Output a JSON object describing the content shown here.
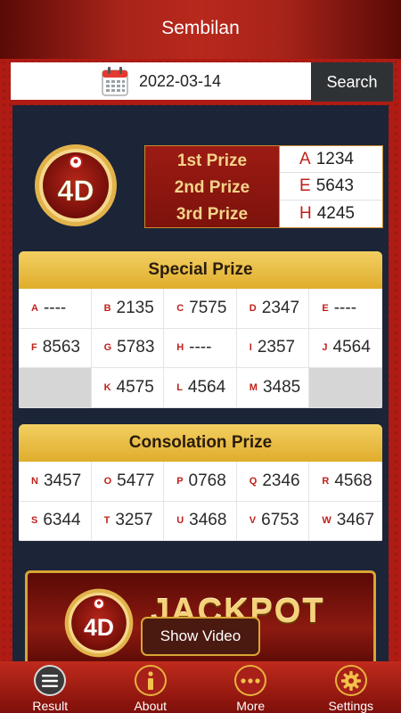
{
  "header": {
    "title": "Sembilan"
  },
  "search": {
    "date": "2022-03-14",
    "button": "Search",
    "icon": "calendar-icon"
  },
  "logo": {
    "text": "4D"
  },
  "top_prizes": [
    {
      "label": "1st Prize",
      "letter": "A",
      "number": "1234"
    },
    {
      "label": "2nd Prize",
      "letter": "E",
      "number": "5643"
    },
    {
      "label": "3rd Prize",
      "letter": "H",
      "number": "4245"
    }
  ],
  "special": {
    "title": "Special Prize",
    "cells": [
      {
        "letter": "A",
        "number": "----"
      },
      {
        "letter": "B",
        "number": "2135"
      },
      {
        "letter": "C",
        "number": "7575"
      },
      {
        "letter": "D",
        "number": "2347"
      },
      {
        "letter": "E",
        "number": "----"
      },
      {
        "letter": "F",
        "number": "8563"
      },
      {
        "letter": "G",
        "number": "5783"
      },
      {
        "letter": "H",
        "number": "----"
      },
      {
        "letter": "I",
        "number": "2357"
      },
      {
        "letter": "J",
        "number": "4564"
      },
      {
        "letter": "",
        "number": ""
      },
      {
        "letter": "K",
        "number": "4575"
      },
      {
        "letter": "L",
        "number": "4564"
      },
      {
        "letter": "M",
        "number": "3485"
      },
      {
        "letter": "",
        "number": ""
      }
    ]
  },
  "consolation": {
    "title": "Consolation Prize",
    "cells": [
      {
        "letter": "N",
        "number": "3457"
      },
      {
        "letter": "O",
        "number": "5477"
      },
      {
        "letter": "P",
        "number": "0768"
      },
      {
        "letter": "Q",
        "number": "2346"
      },
      {
        "letter": "R",
        "number": "4568"
      },
      {
        "letter": "S",
        "number": "6344"
      },
      {
        "letter": "T",
        "number": "3257"
      },
      {
        "letter": "U",
        "number": "3468"
      },
      {
        "letter": "V",
        "number": "6753"
      },
      {
        "letter": "W",
        "number": "3467"
      }
    ]
  },
  "jackpot": {
    "text": "JACKPOT",
    "logo_text": "4D"
  },
  "show_video": "Show Video",
  "tabs": [
    {
      "label": "Result",
      "icon": "list-icon"
    },
    {
      "label": "About",
      "icon": "info-icon"
    },
    {
      "label": "More",
      "icon": "more-icon"
    },
    {
      "label": "Settings",
      "icon": "gear-icon"
    }
  ],
  "colors": {
    "header_red": "#b8281c",
    "gold": "#e0ad2c",
    "navy": "#1c2438",
    "letter_red": "#c0201a"
  }
}
